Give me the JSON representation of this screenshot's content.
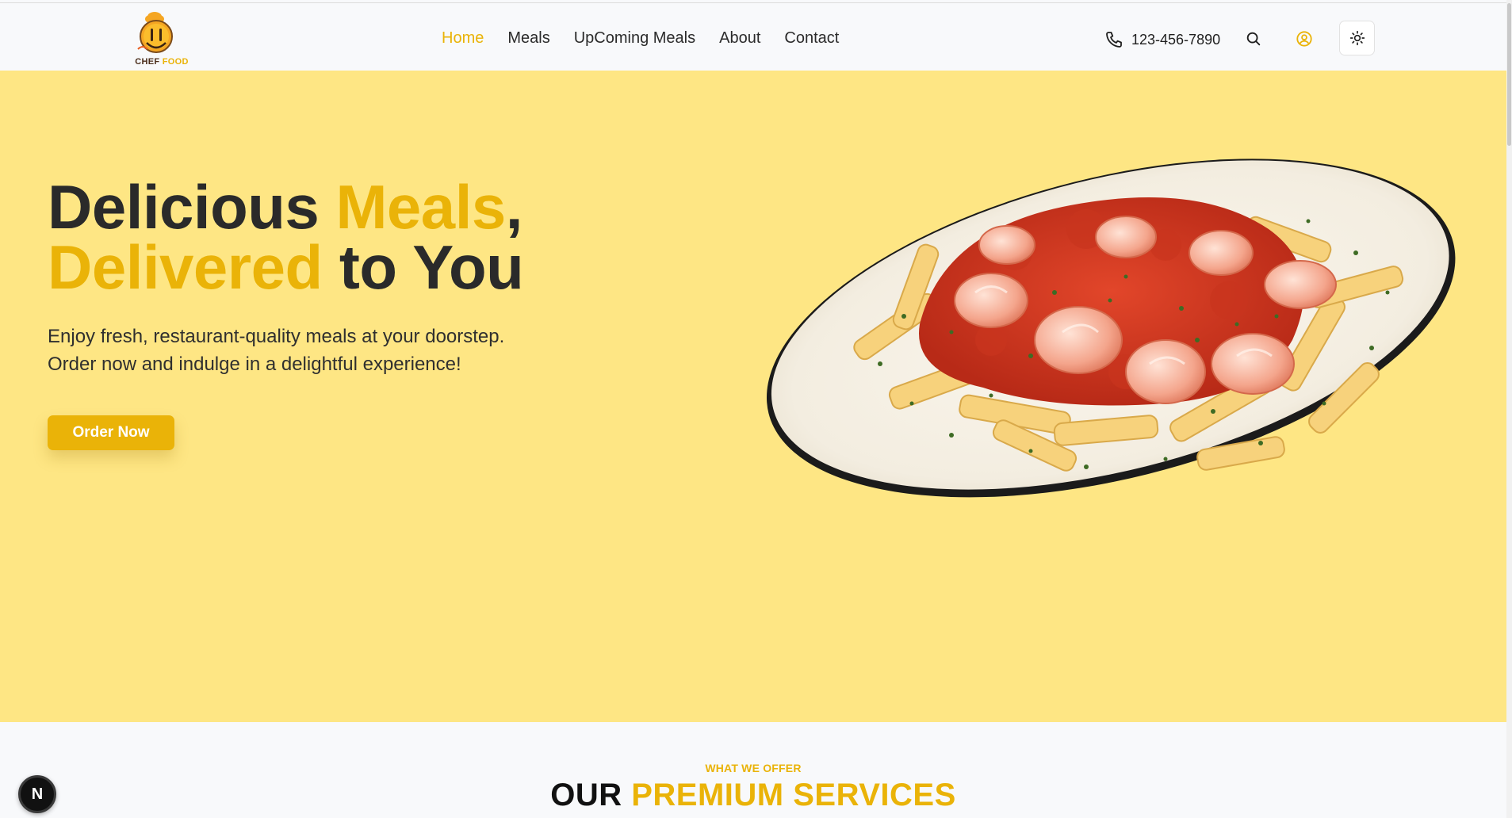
{
  "brand": {
    "name_part1": "CHEF",
    "name_part2": "FOOD"
  },
  "nav": {
    "links": [
      {
        "label": "Home",
        "active": true
      },
      {
        "label": "Meals",
        "active": false
      },
      {
        "label": "UpComing Meals",
        "active": false
      },
      {
        "label": "About",
        "active": false
      },
      {
        "label": "Contact",
        "active": false
      }
    ],
    "phone": "123-456-7890",
    "icons": [
      "phone-icon",
      "search-icon",
      "user-icon",
      "sun-icon"
    ]
  },
  "hero": {
    "title_word1": "Delicious ",
    "title_word2": "Meals",
    "title_word3": ",",
    "title_word4": "Delivered",
    "title_word5": " to You",
    "subtitle_line1": "Enjoy fresh, restaurant-quality meals at your doorstep.",
    "subtitle_line2": "Order now and indulge in a delightful experience!",
    "cta_label": "Order Now"
  },
  "services": {
    "label": "WHAT WE OFFER",
    "title_part1": "OUR ",
    "title_part2": "PREMIUM SERVICES"
  },
  "dev_badge": "N",
  "colors": {
    "accent": "#eab308",
    "hero_bg": "#fee684",
    "page_bg": "#f8f9fb",
    "text_dark": "#2a2a2a"
  }
}
